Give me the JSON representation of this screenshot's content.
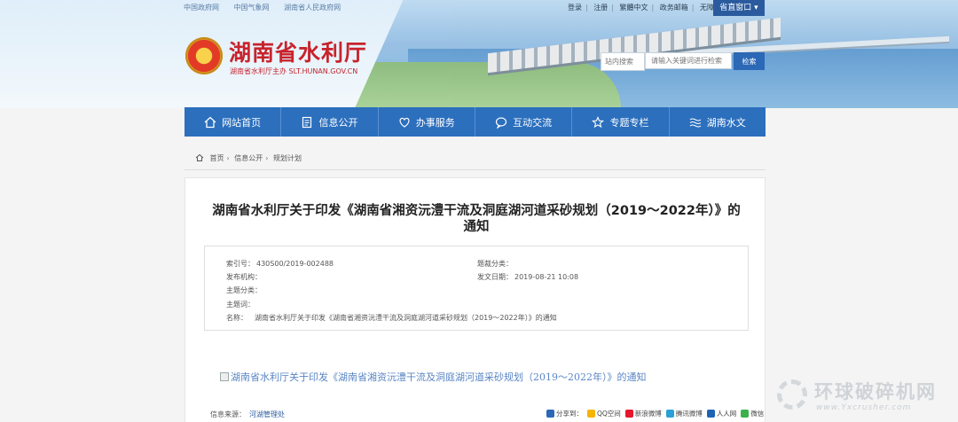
{
  "top_links": [
    "中国政府网",
    "中国气象网",
    "湖南省人民政府网"
  ],
  "util_links": [
    "登录",
    "注册",
    "繁體中文",
    "政务邮箱",
    "无障碍通道"
  ],
  "old_portal_label": "省直窗口",
  "site": {
    "name": "湖南省水利厅",
    "subtitle": "湖南省水利厅主办 SLT.HUNAN.GOV.CN"
  },
  "search": {
    "scope": "站内搜索",
    "placeholder": "请输入关键词进行检索",
    "button": "检索"
  },
  "nav": [
    {
      "label": "网站首页",
      "icon": "home-icon"
    },
    {
      "label": "信息公开",
      "icon": "document-icon"
    },
    {
      "label": "办事服务",
      "icon": "heart-icon"
    },
    {
      "label": "互动交流",
      "icon": "chat-icon"
    },
    {
      "label": "专题专栏",
      "icon": "star-icon"
    },
    {
      "label": "湖南水文",
      "icon": "wave-icon"
    }
  ],
  "breadcrumb": [
    "首页",
    "信息公开",
    "规划计划"
  ],
  "article": {
    "title_line1": "湖南省水利厅关于印发《湖南省湘资沅澧干流及洞庭湖河道采砂规划（2019～2022年）》的",
    "title_line2": "通知",
    "meta": {
      "index_label": "索引号：",
      "index_value": "430S00/2019-002488",
      "category_label": "题裁分类：",
      "category_value": "",
      "publisher_label": "发布机构：",
      "publisher_value": "",
      "date_label": "发文日期：",
      "date_value": "2019-08-21 10:08",
      "topic_label": "主题分类：",
      "topic_value": "",
      "keywords_label": "主题词：",
      "keywords_value": "",
      "name_label": "名称：",
      "name_value": "湖南省水利厅关于印发《湖南省湘资沅澧干流及洞庭湖河道采砂规划（2019～2022年）》的通知"
    },
    "attachment_alt": "湖南省水利厅关于印发《湖南省湘资沅澧干流及洞庭湖河道采砂规划（2019～2022年）》的通知",
    "source_label": "信息来源：",
    "source_value": "河湖管理处",
    "share_label": "分享到：",
    "share_targets": [
      {
        "label": "QQ空间",
        "color": "#f5b400"
      },
      {
        "label": "新浪微博",
        "color": "#e6162d"
      },
      {
        "label": "腾讯微博",
        "color": "#2ba0d6"
      },
      {
        "label": "人人网",
        "color": "#1d65b3"
      },
      {
        "label": "微信",
        "color": "#3bb04b"
      }
    ]
  },
  "watermark": {
    "text": "环球破碎机网",
    "url": "www.Yxcrusher.com"
  },
  "colors": {
    "nav_bg": "#2c6fbd",
    "brand_red": "#c8232c",
    "link_blue": "#2c5d9e"
  }
}
